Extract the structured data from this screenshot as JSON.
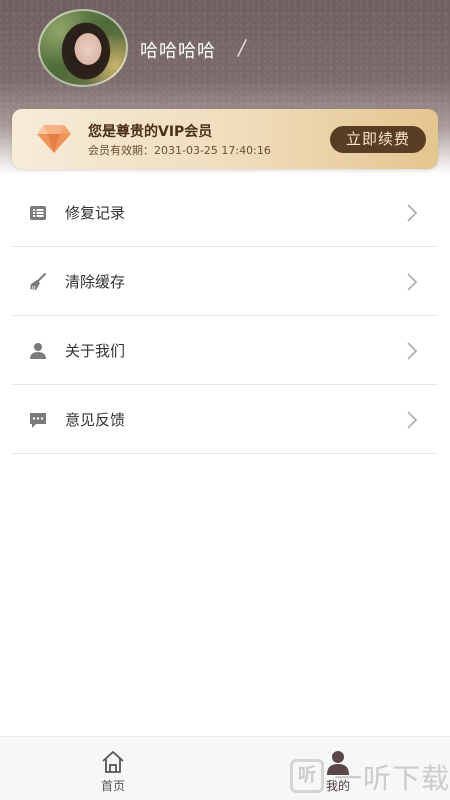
{
  "profile": {
    "username": "哈哈哈哈"
  },
  "vip": {
    "title": "您是尊贵的VIP会员",
    "expiry": "会员有效期：2031-03-25 17:40:16",
    "renew_label": "立即续费"
  },
  "menu": {
    "items": [
      {
        "label": "修复记录",
        "icon": "list-icon"
      },
      {
        "label": "清除缓存",
        "icon": "broom-icon"
      },
      {
        "label": "关于我们",
        "icon": "person-icon"
      },
      {
        "label": "意见反馈",
        "icon": "chat-bubble-icon"
      }
    ]
  },
  "tabbar": {
    "home_label": "首页",
    "mine_label": "我的",
    "active": "我的"
  },
  "watermark": {
    "logo_text": "听",
    "text": "一听下载"
  },
  "colors": {
    "header_bg": "#7b6b6b",
    "vip_gold": "#efdcba",
    "renew_button": "#5a3e24",
    "icon_gray": "#7a7a7a"
  }
}
